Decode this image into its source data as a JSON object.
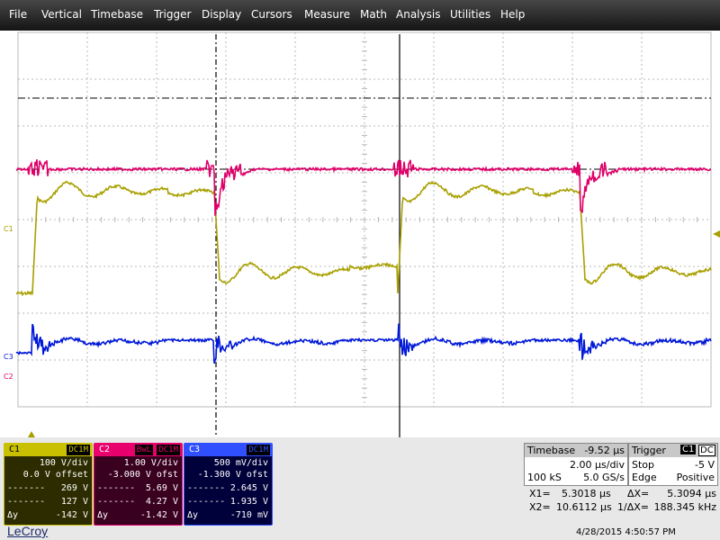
{
  "menu": [
    "File",
    "Vertical",
    "Timebase",
    "Trigger",
    "Display",
    "Cursors",
    "Measure",
    "Math",
    "Analysis",
    "Utilities",
    "Help"
  ],
  "markers": {
    "c1": "C1",
    "c2": "C2",
    "c3": "C3"
  },
  "colors": {
    "c1": "#a8a000",
    "c2": "#e0006a",
    "c3": "#0018d8",
    "grid": "#b8b8b8",
    "cursor": "#000000"
  },
  "channels": [
    {
      "id": "C1",
      "coupling": "DC1M",
      "bwl": "",
      "vdiv": "100 V/div",
      "offset": "0.0 V offset",
      "r1_label": "-------",
      "r1": "269 V",
      "r2_label": "-------",
      "r2": "127 V",
      "dy_label": "Δy",
      "dy": "-142 V"
    },
    {
      "id": "C2",
      "coupling": "DC1M",
      "bwl": "BwL",
      "vdiv": "1.00 V/div",
      "offset": "-3.000 V ofst",
      "r1_label": "-------",
      "r1": "5.69 V",
      "r2_label": "-------",
      "r2": "4.27 V",
      "dy_label": "Δy",
      "dy": "-1.42 V"
    },
    {
      "id": "C3",
      "coupling": "DC1M",
      "bwl": "",
      "vdiv": "500 mV/div",
      "offset": "-1.300 V ofst",
      "r1_label": "-------",
      "r1": "2.645 V",
      "r2_label": "-------",
      "r2": "1.935 V",
      "dy_label": "Δy",
      "dy": "-710 mV"
    }
  ],
  "timebase": {
    "label": "Timebase",
    "delay": "-9.52 µs",
    "div": "2.00 µs/div",
    "samples": "100 kS",
    "rate": "5.0 GS/s"
  },
  "trigger": {
    "label": "Trigger",
    "src": "C1",
    "coupling": "DC",
    "mode": "Stop",
    "level": "-5 V",
    "type": "Edge",
    "slope": "Positive"
  },
  "cursors": {
    "x1_label": "X1=",
    "x1": "5.3018 µs",
    "dx_label": "ΔX=",
    "dx": "5.3094 µs",
    "x2_label": "X2=",
    "x2": "10.6112 µs",
    "inv_label": "1/ΔX=",
    "inv": "188.345 kHz"
  },
  "brand": "LeCroy",
  "datetime": "4/28/2015 4:50:57 PM"
}
